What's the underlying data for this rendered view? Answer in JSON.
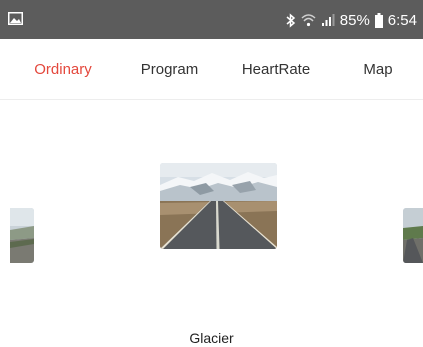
{
  "status_bar": {
    "left_icon": "image-icon",
    "icons": [
      "bluetooth-icon",
      "wifi-icon",
      "signal-icon",
      "battery-icon"
    ],
    "battery": "85%",
    "time": "6:54"
  },
  "tabs": [
    {
      "label": "Ordinary",
      "active": true
    },
    {
      "label": "Program",
      "active": false
    },
    {
      "label": "HeartRate",
      "active": false
    },
    {
      "label": "Map",
      "active": false
    }
  ],
  "carousel": {
    "selected_scene": "Glacier"
  },
  "colors": {
    "status_bar_bg": "#5c5c5c",
    "active_tab": "#e4483d",
    "text": "#333333"
  }
}
